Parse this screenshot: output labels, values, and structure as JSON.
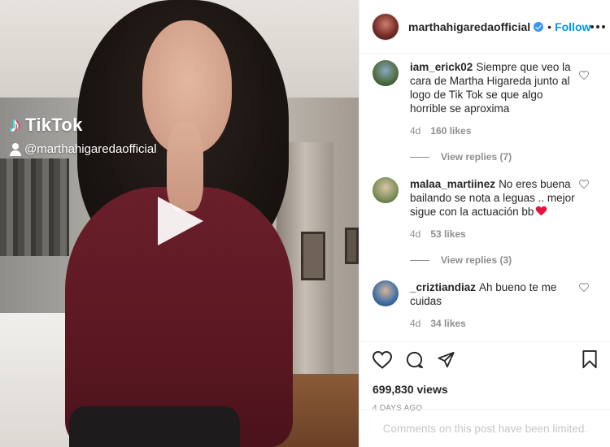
{
  "media": {
    "overlay": {
      "brand": "TikTok",
      "handle": "@marthahigaredaofficial"
    }
  },
  "header": {
    "username": "marthahigaredaofficial",
    "separator": "•",
    "follow_label": "Follow"
  },
  "comments": [
    {
      "username": "iam_erick02",
      "text": "Siempre que veo la cara de Martha Higareda junto al logo de Tik Tok se que algo horrible se aproxima",
      "age": "4d",
      "likes": "160 likes",
      "replies": "View replies (7)"
    },
    {
      "username": "malaa_martiinez",
      "text": "No eres buena bailando se nota a leguas .. mejor sigue con la actuación bb",
      "age": "4d",
      "likes": "53 likes",
      "replies": "View replies (3)"
    },
    {
      "username": "_criztiandiaz",
      "text": "Ah bueno te me cuidas",
      "age": "4d",
      "likes": "34 likes"
    }
  ],
  "post": {
    "views": "699,830 views",
    "timestamp": "4 DAYS AGO",
    "limited_notice": "Comments on this post have been limited."
  },
  "icons": {
    "like": "heart-icon",
    "comment": "comment-icon",
    "share": "paper-plane-icon",
    "save": "bookmark-icon",
    "verified": "verified-badge-icon",
    "more": "more-options-icon"
  },
  "colors": {
    "accent": "#0095f6",
    "verified": "#3897f0",
    "muted": "#8e8e8e",
    "emoji_heart": "#e0173a"
  }
}
